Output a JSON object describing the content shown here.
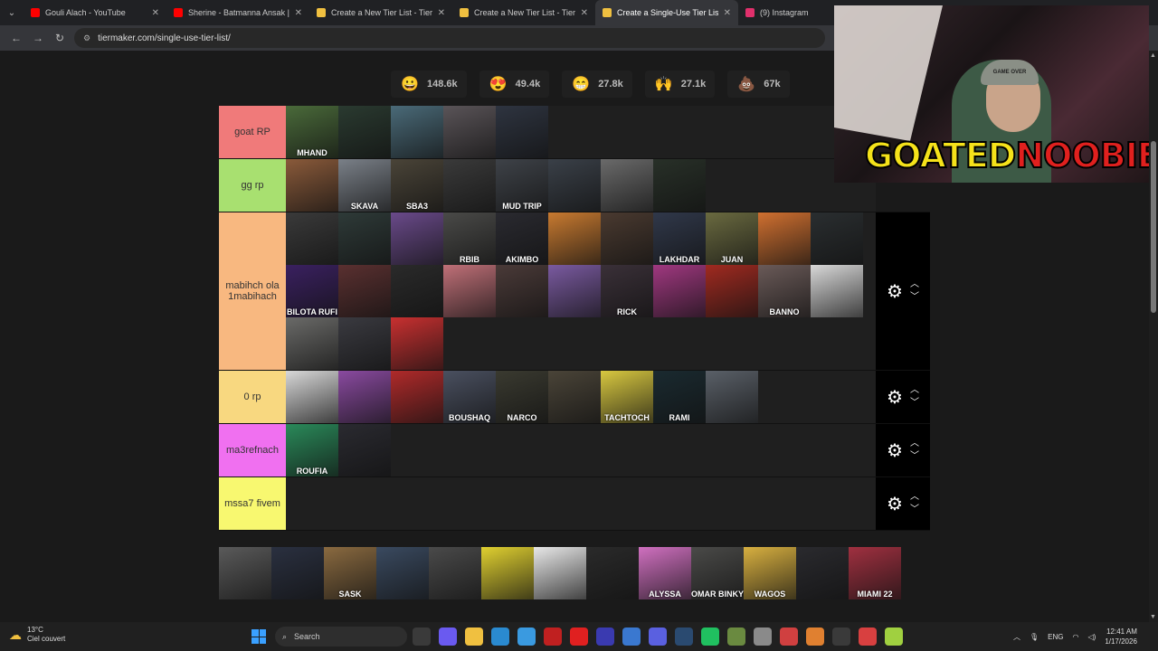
{
  "browser": {
    "tabs": [
      {
        "title": "Gouli Alach - YouTube",
        "color": "#ff0000",
        "active": false
      },
      {
        "title": "Sherine - Batmanna Ansak | شير",
        "color": "#ff0000",
        "active": false
      },
      {
        "title": "Create a New Tier List - TierMaker",
        "color": "#f0c040",
        "active": false
      },
      {
        "title": "Create a New Tier List - TierMaker",
        "color": "#f0c040",
        "active": false
      },
      {
        "title": "Create a Single-Use Tier List (Fr",
        "color": "#f0c040",
        "active": true
      },
      {
        "title": "(9) Instagram",
        "color": "#e1306c",
        "active": false
      }
    ],
    "url": "tiermaker.com/single-use-tier-list/"
  },
  "reactions": [
    {
      "icon": "grinning-face-icon",
      "glyph": "😀",
      "count": "148.6k"
    },
    {
      "icon": "heart-eyes-icon",
      "glyph": "😍",
      "count": "49.4k"
    },
    {
      "icon": "rainbow-mouth-icon",
      "glyph": "😁",
      "count": "27.8k"
    },
    {
      "icon": "raised-hands-icon",
      "glyph": "🙌",
      "count": "27.1k"
    },
    {
      "icon": "poop-icon",
      "glyph": "💩",
      "count": "67k"
    }
  ],
  "tiers": [
    {
      "label": "goat RP",
      "color": "#f07a7a",
      "controls": false,
      "items": [
        {
          "c": "#4a6a3a",
          "t": "MHAND"
        },
        {
          "c": "#2a3a30",
          "t": ""
        },
        {
          "c": "#4a6a78",
          "t": ""
        },
        {
          "c": "#5a5458",
          "t": ""
        },
        {
          "c": "#2e3440",
          "t": ""
        }
      ]
    },
    {
      "label": "gg rp",
      "color": "#a8e070",
      "controls": false,
      "items": [
        {
          "c": "#8a5a3a",
          "t": ""
        },
        {
          "c": "#7a8088",
          "t": "SKAVA"
        },
        {
          "c": "#4a4438",
          "t": "SBA3"
        },
        {
          "c": "#3a3a3a",
          "t": ""
        },
        {
          "c": "#3e4248",
          "t": "MUD TRIP"
        },
        {
          "c": "#3a4048",
          "t": ""
        },
        {
          "c": "#6a6a6a",
          "t": ""
        },
        {
          "c": "#283028",
          "t": ""
        }
      ]
    },
    {
      "label": "mabihch ola 1mabihach",
      "color": "#f8b880",
      "controls": true,
      "items": [
        {
          "c": "#3a3a3a",
          "t": ""
        },
        {
          "c": "#2e3a38",
          "t": ""
        },
        {
          "c": "#6a4a8a",
          "t": ""
        },
        {
          "c": "#4a4a48",
          "t": "RBIB"
        },
        {
          "c": "#2a2a30",
          "t": "AKIMBO"
        },
        {
          "c": "#c87a30",
          "t": ""
        },
        {
          "c": "#4a3a30",
          "t": ""
        },
        {
          "c": "#30384a",
          "t": "LAKHDAR"
        },
        {
          "c": "#6a6a40",
          "t": "JUAN"
        },
        {
          "c": "#d07030",
          "t": ""
        },
        {
          "c": "#2a2e30",
          "t": ""
        },
        {
          "c": "#3a2060",
          "t": "BILOTA RUFI"
        },
        {
          "c": "#5a3030",
          "t": ""
        },
        {
          "c": "#2a2a2a",
          "t": ""
        },
        {
          "c": "#c07078",
          "t": ""
        },
        {
          "c": "#4a3a38",
          "t": ""
        },
        {
          "c": "#7a5aa0",
          "t": ""
        },
        {
          "c": "#3a3038",
          "t": "RICK"
        },
        {
          "c": "#a03880",
          "t": ""
        },
        {
          "c": "#a02a20",
          "t": ""
        },
        {
          "c": "#6a5a58",
          "t": "BANNO"
        },
        {
          "c": "#d8d8d8",
          "t": ""
        },
        {
          "c": "#6a6a68",
          "t": ""
        },
        {
          "c": "#3a3a40",
          "t": ""
        },
        {
          "c": "#c83030",
          "t": ""
        }
      ]
    },
    {
      "label": "0 rp",
      "color": "#f8d880",
      "controls": true,
      "items": [
        {
          "c": "#d8d8d8",
          "t": ""
        },
        {
          "c": "#8a4aa0",
          "t": ""
        },
        {
          "c": "#b02a2a",
          "t": ""
        },
        {
          "c": "#4a5060",
          "t": "BOUSHAQ"
        },
        {
          "c": "#3a3a30",
          "t": "NARCO"
        },
        {
          "c": "#4a4438",
          "t": ""
        },
        {
          "c": "#d8c840",
          "t": "TACHTOCH"
        },
        {
          "c": "#1a2a30",
          "t": "RAMI"
        },
        {
          "c": "#5a6068",
          "t": ""
        }
      ]
    },
    {
      "label": "ma3refnach",
      "color": "#f070f0",
      "controls": true,
      "items": [
        {
          "c": "#2a8a5a",
          "t": "ROUFIA"
        },
        {
          "c": "#2a2a30",
          "t": ""
        }
      ]
    },
    {
      "label": "mssa7 fivem",
      "color": "#f8f870",
      "controls": true,
      "items": []
    }
  ],
  "pool": [
    {
      "c": "#5a5a5a",
      "t": ""
    },
    {
      "c": "#2a3040",
      "t": ""
    },
    {
      "c": "#8a6a40",
      "t": "SASK"
    },
    {
      "c": "#3a4a60",
      "t": ""
    },
    {
      "c": "#4a4a4a",
      "t": ""
    },
    {
      "c": "#e0d030",
      "t": ""
    },
    {
      "c": "#e8e8e8",
      "t": ""
    },
    {
      "c": "#2a2a2a",
      "t": ""
    },
    {
      "c": "#d070c0",
      "t": "ALYSSA"
    },
    {
      "c": "#4a4a48",
      "t": "OMAR BINKY"
    },
    {
      "c": "#d8b040",
      "t": "WAGOS"
    },
    {
      "c": "#2a2a2e",
      "t": ""
    },
    {
      "c": "#a03040",
      "t": "MIAMI 22"
    }
  ],
  "webcam": {
    "cap_text": "GAME OVER",
    "logo_a": "GOATED",
    "logo_b": "NOOBIE"
  },
  "taskbar": {
    "temp": "13°C",
    "weather": "Ciel couvert",
    "search_placeholder": "Search",
    "lang": "ENG",
    "time": "12:41 AM",
    "date": "1/17/2026",
    "icons": [
      "#3a3a3a",
      "#6a5af0",
      "#f0c040",
      "#2a8ad0",
      "#3a9ae0",
      "#c02020",
      "#e02020",
      "#3a3ab0",
      "#3a78d0",
      "#5a60e0",
      "#2a4a70",
      "#20c060",
      "#6a8a40",
      "#8a8a8a",
      "#d04040",
      "#e08030",
      "#3a3a3a",
      "#d84040",
      "#a0d040"
    ]
  }
}
